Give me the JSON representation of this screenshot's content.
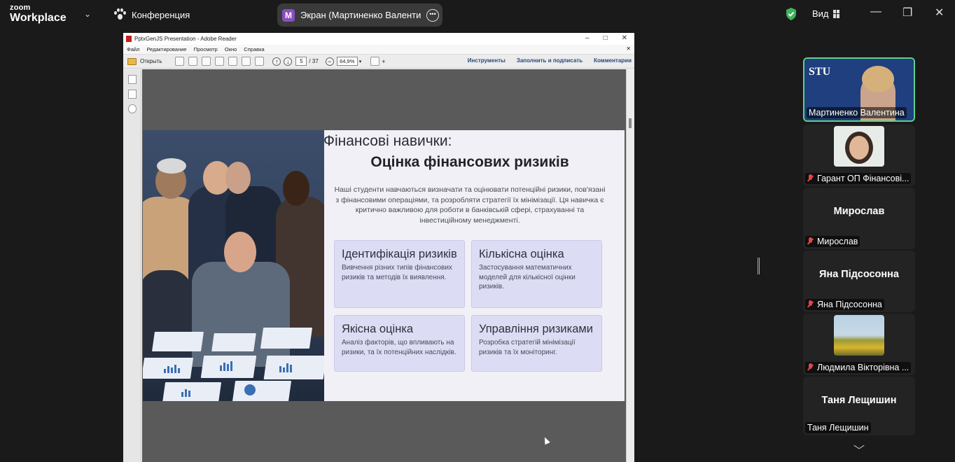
{
  "zoom": {
    "logo_line1": "zoom",
    "logo_line2": "Workplace",
    "conference_label": "Конференция",
    "share_badge": "M",
    "share_label": "Экран (Мартиненко Валентина)",
    "view_label": "Вид",
    "accent": "#5fd18b"
  },
  "reader": {
    "title": "PptxGenJS Presentation - Adobe Reader",
    "menu": [
      "Файл",
      "Редактирование",
      "Просмотр",
      "Окно",
      "Справка"
    ],
    "open_label": "Открыть",
    "page_current": "5",
    "page_total": "/ 37",
    "zoom_value": "64,9%",
    "tools": [
      "Инструменты",
      "Заполнить и подписать",
      "Комментарии"
    ]
  },
  "slide": {
    "title": "Фінансові навички:",
    "heading": "Оцінка фінансових ризиків",
    "description": "Наші студенти навчаються визначати та оцінювати потенційні ризики, пов'язані з фінансовими операціями, та розробляти стратегії їх мінімізації. Ця навичка є критично важливою для роботи в банківській сфері, страхуванні та інвестиційному менеджменті.",
    "cards": [
      {
        "title": "Ідентифікація ризиків",
        "text": "Вивчення різних типів фінансових ризиків та методів їх виявлення."
      },
      {
        "title": "Кількісна оцінка",
        "text": "Застосування математичних моделей для кількісної оцінки ризиків."
      },
      {
        "title": "Якісна оцінка",
        "text": "Аналіз факторів, що впливають на ризики, та їх потенційних наслідків."
      },
      {
        "title": "Управління ризиками",
        "text": "Розробка стратегій мінімізації ризиків та їх моніторинг."
      }
    ]
  },
  "participants": [
    {
      "name": "Мартиненко Валентина",
      "logo_text": "STU",
      "muted": false
    },
    {
      "name": "Гарант ОП Фінансові...",
      "muted": true
    },
    {
      "big": "Мирослав",
      "name": "Мирослав",
      "muted": true
    },
    {
      "big": "Яна Підсосонна",
      "name": "Яна Підсосонна",
      "muted": true
    },
    {
      "name": "Людмила Вікторівна ...",
      "muted": true
    },
    {
      "big": "Таня Лещишин",
      "name": "Таня Лещишин",
      "muted": false
    }
  ]
}
